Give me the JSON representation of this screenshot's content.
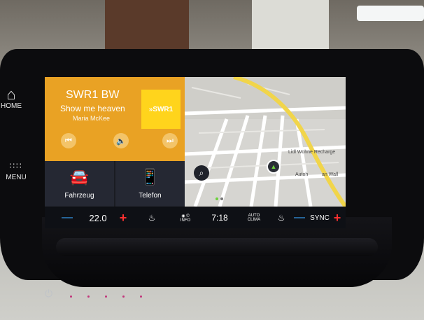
{
  "side": {
    "home_label": "HOME",
    "menu_label": "MENU",
    "home_icon": "home-icon",
    "menu_icon": "grid-icon"
  },
  "radio": {
    "station": "SWR1 BW",
    "song": "Show me heaven",
    "artist": "Maria McKee",
    "logo": "»SWR1",
    "controls": {
      "prev": "⏮",
      "mute": "🔈",
      "next": "⏭"
    }
  },
  "tiles": [
    {
      "label": "Fahrzeug",
      "icon": "car-icon"
    },
    {
      "label": "Telefon",
      "icon": "phone-icon"
    }
  ],
  "map": {
    "pois": [
      "Lidl Wohne Recharge",
      "Autoh",
      "an Wall"
    ],
    "search_icon": "search-icon",
    "position_icon": "navigation-arrow-icon"
  },
  "climate": {
    "temp_left": "22.0",
    "time": "7:18",
    "info_label": "INFO",
    "clima_label": "CLIMA",
    "auto_label": "AUTO",
    "sync_label": "SYNC"
  },
  "colors": {
    "radio_tile": "#e9a224",
    "logo": "#ffd41c",
    "accent_green": "#6cd13c",
    "minus": "#39a7ff",
    "plus": "#ff3030"
  }
}
